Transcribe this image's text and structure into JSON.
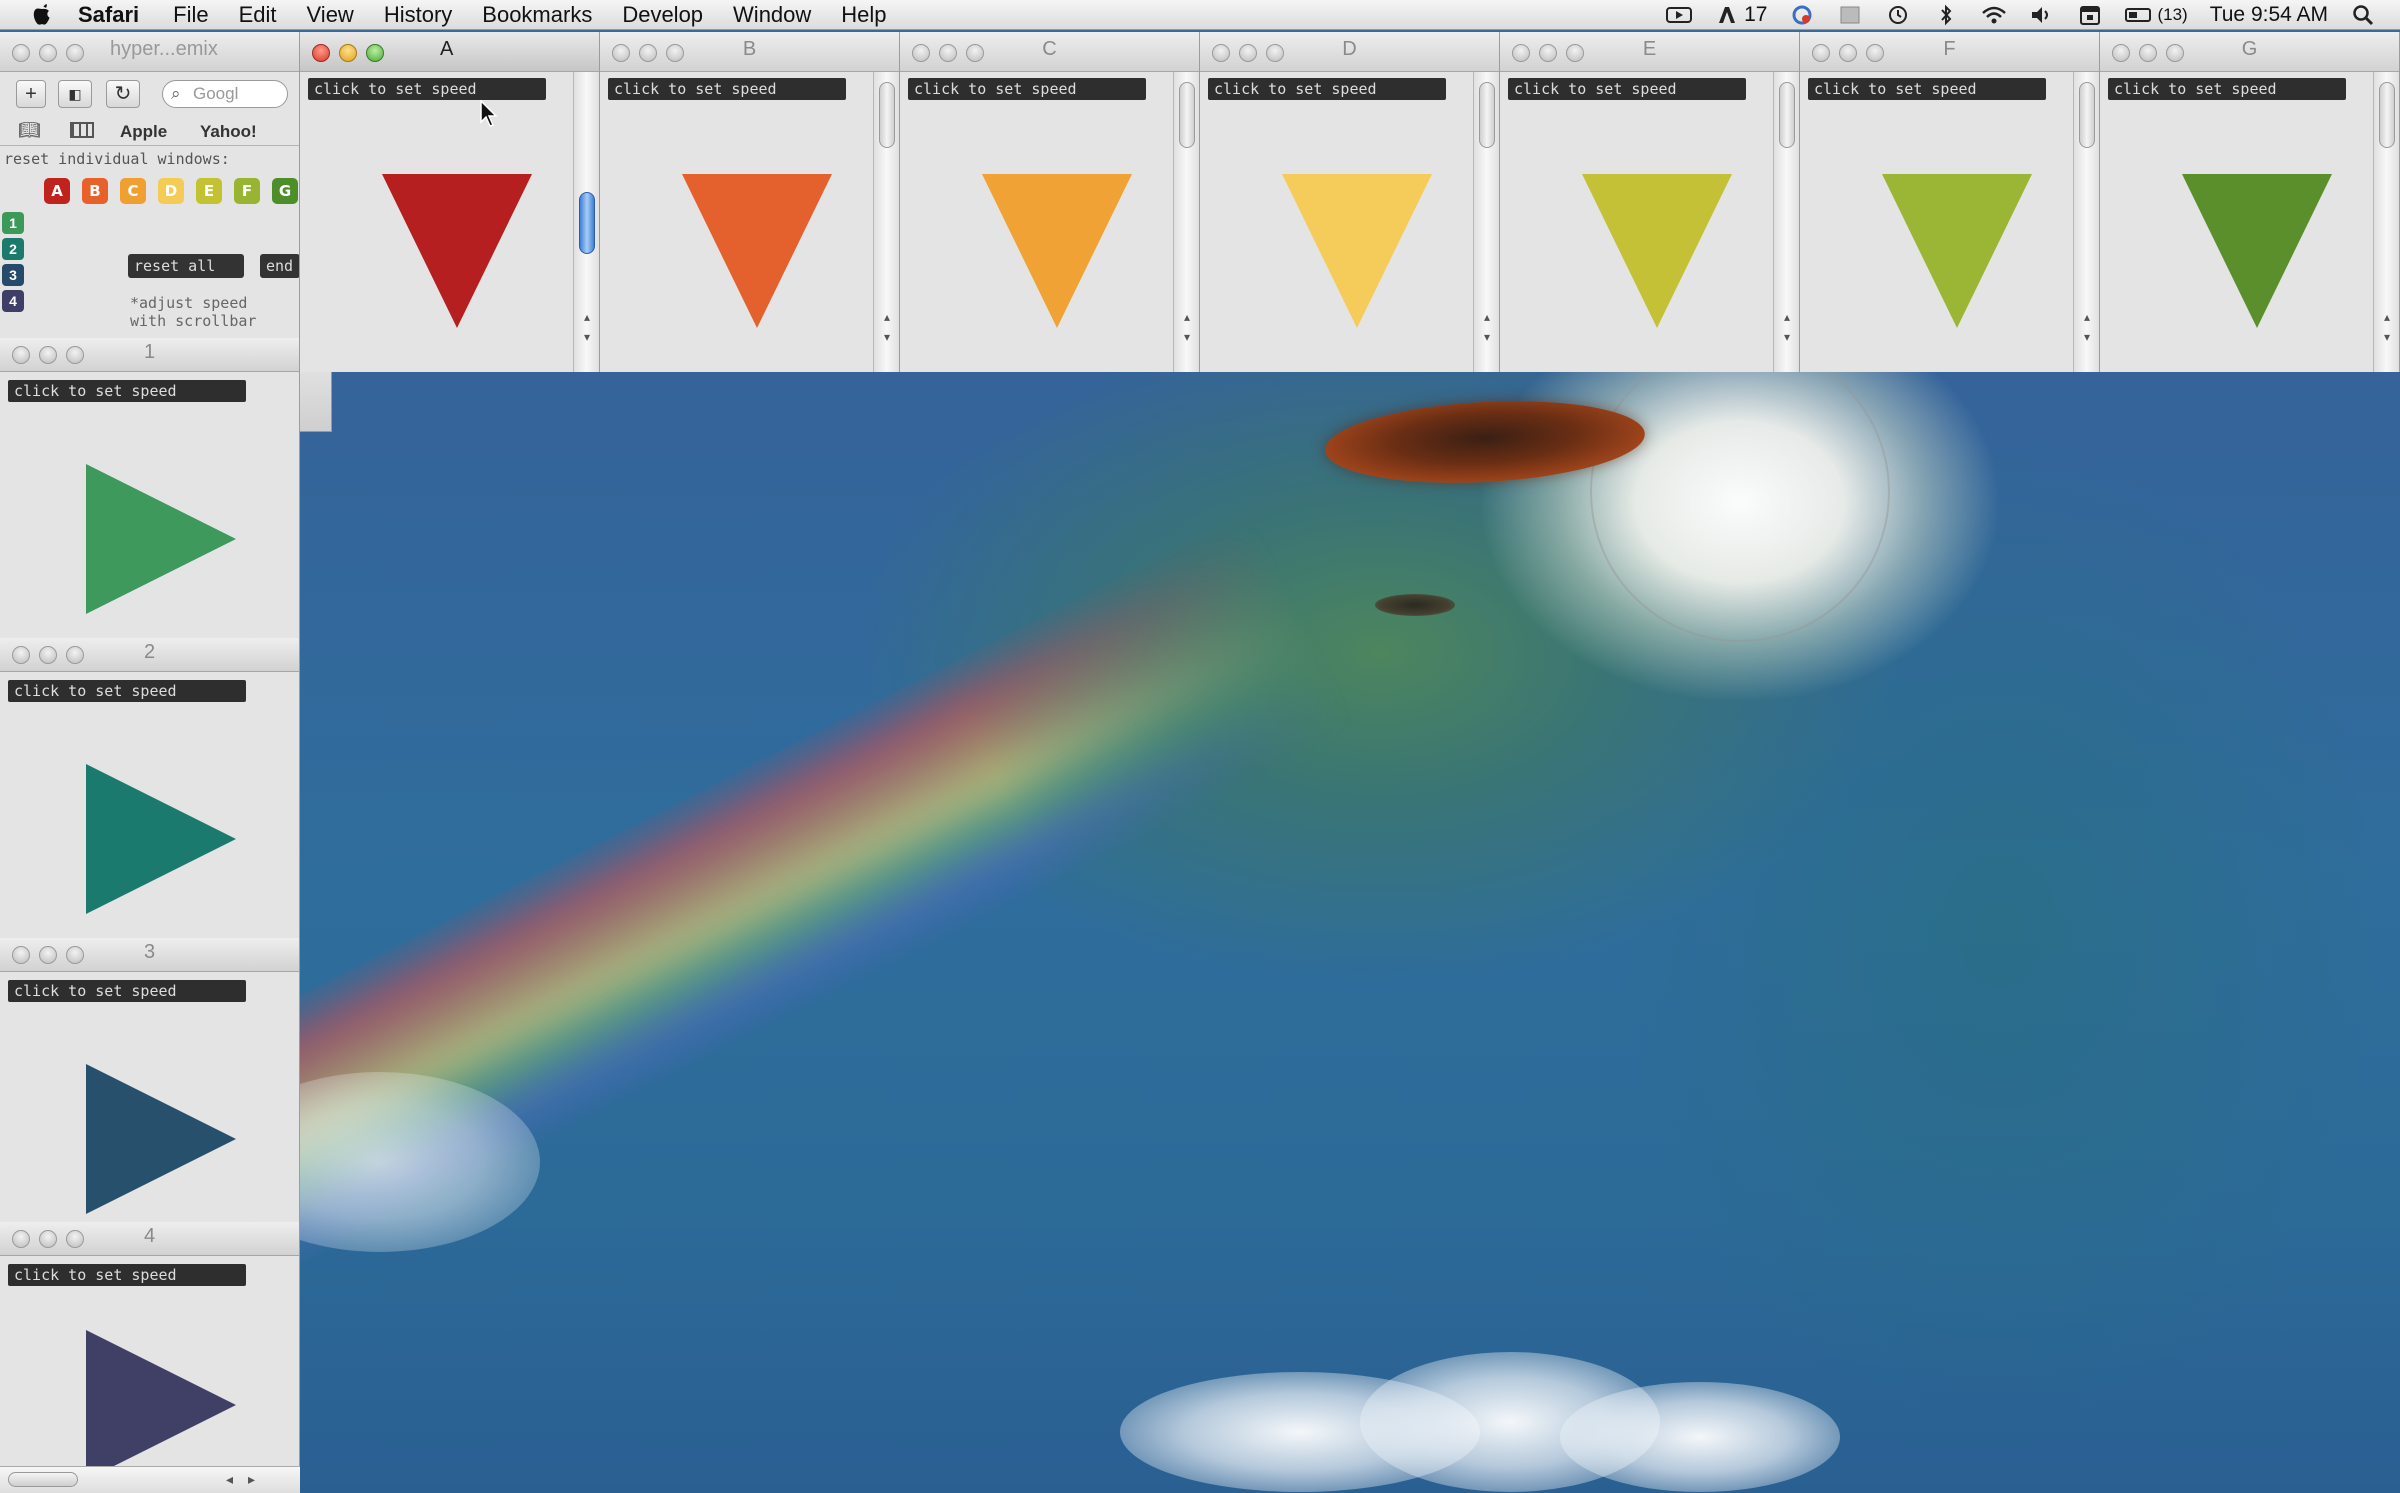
{
  "menubar": {
    "app_name": "Safari",
    "menus": [
      "File",
      "Edit",
      "View",
      "History",
      "Bookmarks",
      "Develop",
      "Window",
      "Help"
    ],
    "status": {
      "count": "17",
      "battery": "(13)",
      "clock": "Tue 9:54 AM"
    }
  },
  "browser": {
    "title": "hyper...emix",
    "search_placeholder": "Googl",
    "bookmarks": [
      "Apple",
      "Yahoo!"
    ],
    "caption": "reset individual windows:",
    "letters": [
      "A",
      "B",
      "C",
      "D",
      "E",
      "F",
      "G"
    ],
    "letter_colors": [
      "#c0221e",
      "#e8602a",
      "#f0a030",
      "#f4cc55",
      "#c2c232",
      "#98b430",
      "#4e8e2a"
    ],
    "numbers": [
      "1",
      "2",
      "3",
      "4"
    ],
    "number_colors": [
      "#3b9a5a",
      "#1a7a6c",
      "#264a6a",
      "#3e3e66"
    ],
    "reset_all": "reset all",
    "end": "end",
    "note_line1": "*adjust speed",
    "note_line2": "with scrollbar"
  },
  "speed_label": "click to set speed",
  "top_windows": [
    {
      "title": "A",
      "color": "#b51f1f",
      "active": true
    },
    {
      "title": "B",
      "color": "#e4602c"
    },
    {
      "title": "C",
      "color": "#f0a334"
    },
    {
      "title": "D",
      "color": "#f5cc5a"
    },
    {
      "title": "E",
      "color": "#c4c136"
    },
    {
      "title": "F",
      "color": "#9bb535"
    },
    {
      "title": "G",
      "color": "#5a8f2c"
    }
  ],
  "side_windows": [
    {
      "title": "1",
      "color": "#3e9a5c"
    },
    {
      "title": "2",
      "color": "#1b7a6e"
    },
    {
      "title": "3",
      "color": "#27506c"
    },
    {
      "title": "4",
      "color": "#403f66"
    }
  ]
}
